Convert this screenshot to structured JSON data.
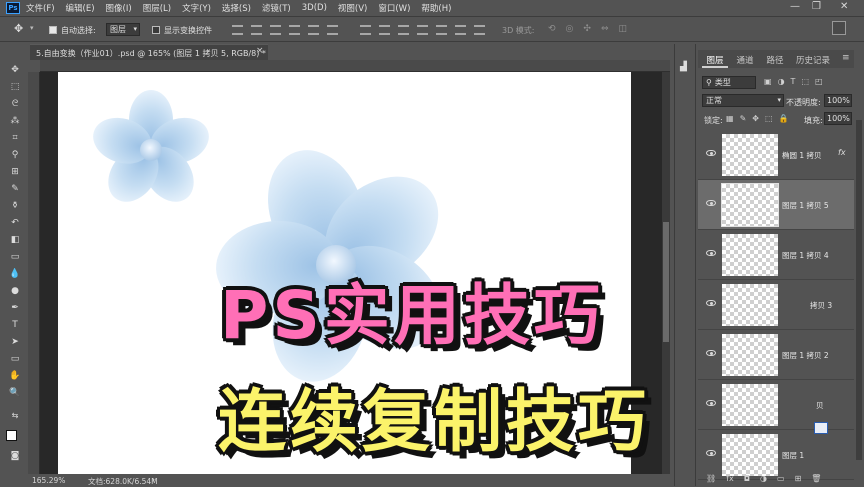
{
  "menubar": {
    "logo": "Ps",
    "items": [
      "文件(F)",
      "编辑(E)",
      "图像(I)",
      "图层(L)",
      "文字(Y)",
      "选择(S)",
      "滤镜(T)",
      "3D(D)",
      "视图(V)",
      "窗口(W)",
      "帮助(H)"
    ],
    "window_controls": [
      "—",
      "❐",
      "✕"
    ]
  },
  "options": {
    "auto_select_label": "自动选择:",
    "auto_select_checked": true,
    "auto_select_target": "图层",
    "show_transform_label": "显示变换控件",
    "show_transform_checked": false,
    "mode_3d_label": "3D 模式:"
  },
  "document": {
    "tab_title": "5.自由变换（作业01）.psd @ 165% (图层 1 拷贝 5, RGB/8) *",
    "close": "×"
  },
  "status": {
    "zoom": "165.29%",
    "doc_info": "文档:628.0K/6.54M",
    "arrow": "›"
  },
  "layers_panel": {
    "tabs": [
      "图层",
      "通道",
      "路径",
      "历史记录"
    ],
    "active_tab": "图层",
    "filter_label": "类型",
    "blend_mode": "正常",
    "opacity_label": "不透明度:",
    "opacity_value": "100%",
    "lock_label": "锁定:",
    "fill_label": "填充:",
    "fill_value": "100%",
    "fx_label": "fx",
    "layers": [
      {
        "name": "椭圆 1 拷贝",
        "selected": false
      },
      {
        "name": "图层 1 拷贝 5",
        "selected": true
      },
      {
        "name": "图层 1 拷贝 4",
        "selected": false
      },
      {
        "name": "拷贝 3",
        "selected": false
      },
      {
        "name": "图层 1 拷贝 2",
        "selected": false
      },
      {
        "name": "贝",
        "selected": false
      },
      {
        "name": "图层 1",
        "selected": false
      }
    ]
  },
  "overlay": {
    "line1": "PS实用技巧",
    "line2": "连续复制技巧"
  },
  "colors": {
    "banner_pink": "#ff6fb6",
    "banner_yellow": "#fbf36a",
    "petal_blue": "#bcd6ef",
    "ui_gray": "#535353"
  }
}
